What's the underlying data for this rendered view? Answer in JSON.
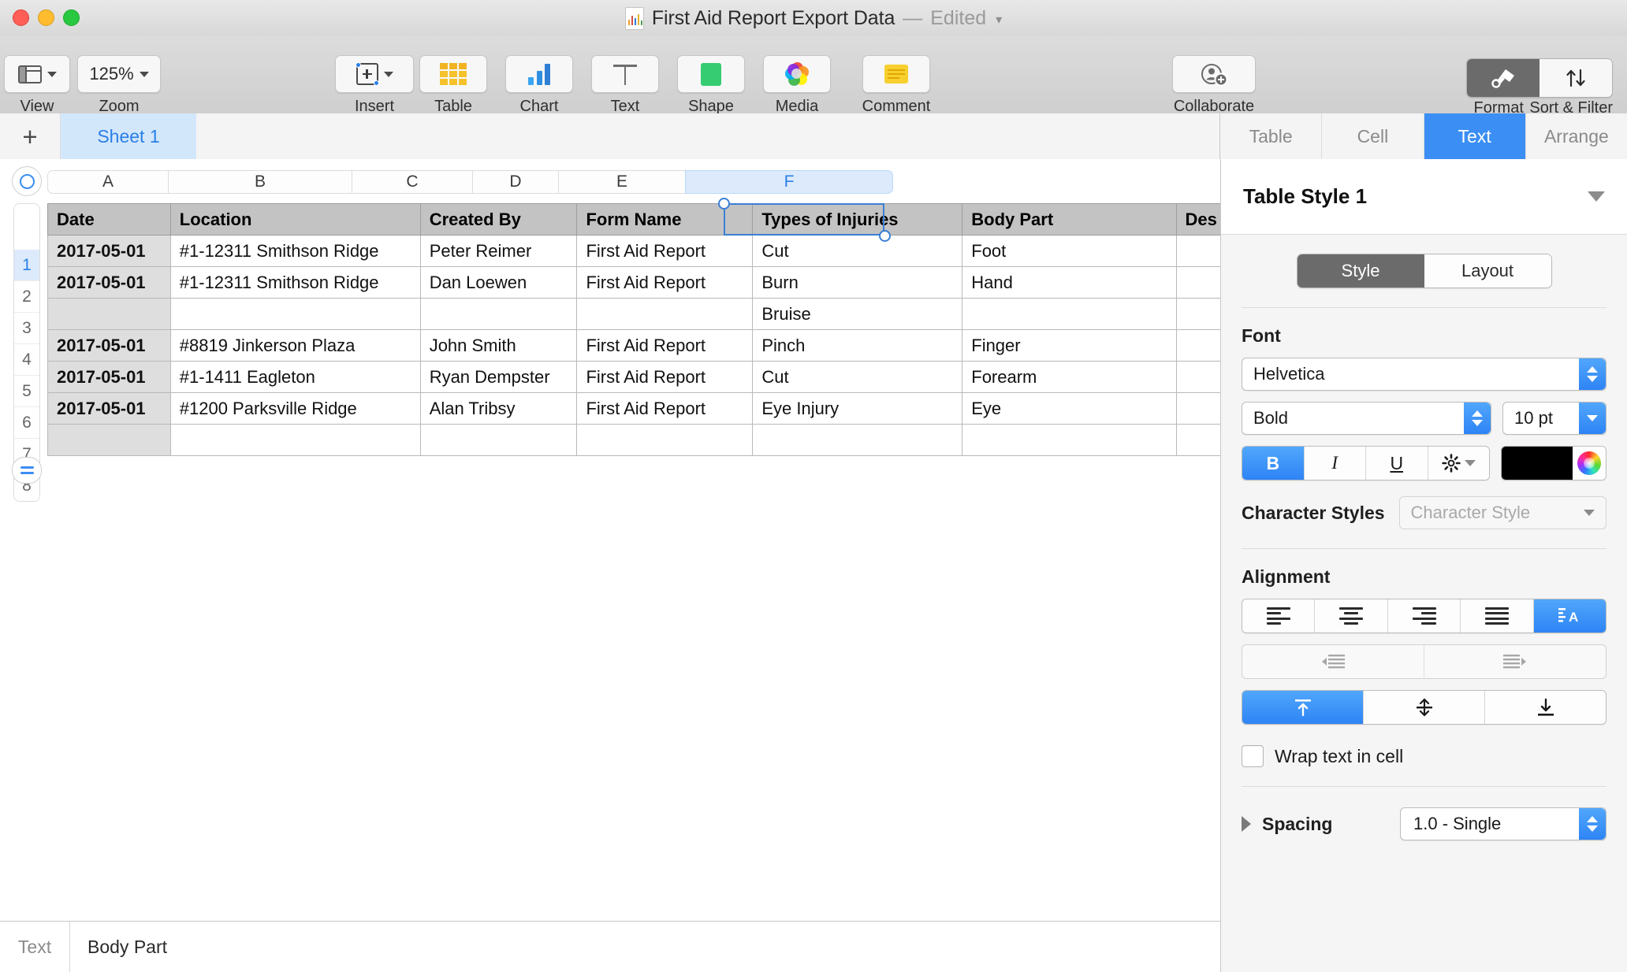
{
  "window": {
    "title": "First Aid Report Export Data",
    "dash": "—",
    "edited": "Edited",
    "doc_icon": "numbers-document-icon"
  },
  "toolbar": {
    "view_label": "View",
    "zoom_label": "Zoom",
    "zoom_value": "125%",
    "insert_label": "Insert",
    "table_label": "Table",
    "chart_label": "Chart",
    "text_label": "Text",
    "shape_label": "Shape",
    "media_label": "Media",
    "comment_label": "Comment",
    "collaborate_label": "Collaborate",
    "format_label": "Format",
    "sort_filter_label": "Sort & Filter"
  },
  "sheetbar": {
    "add_label": "+",
    "tabs": [
      {
        "label": "Sheet 1",
        "active": true
      }
    ]
  },
  "inspector_tabs": [
    {
      "label": "Table",
      "active": false
    },
    {
      "label": "Cell",
      "active": false
    },
    {
      "label": "Text",
      "active": true
    },
    {
      "label": "Arrange",
      "active": false
    }
  ],
  "spreadsheet": {
    "column_letters": [
      "A",
      "B",
      "C",
      "D",
      "E",
      "F"
    ],
    "selected_column": "F",
    "row_numbers": [
      "1",
      "2",
      "3",
      "4",
      "5",
      "6",
      "7",
      "8"
    ],
    "selected_row": "1",
    "headers": [
      "Date",
      "Location",
      "Created By",
      "Form Name",
      "Types of Injuries",
      "Body Part",
      "Des"
    ],
    "selected_cell": "Body Part",
    "rows": [
      [
        "2017-05-01",
        "#1-12311 Smithson Ridge",
        "Peter Reimer",
        "First Aid Report",
        "Cut",
        "Foot",
        ""
      ],
      [
        "2017-05-01",
        "#1-12311 Smithson Ridge",
        "Dan Loewen",
        "First Aid Report",
        "Burn",
        "Hand",
        ""
      ],
      [
        "",
        "",
        "",
        "",
        "Bruise",
        "",
        ""
      ],
      [
        "2017-05-01",
        "#8819 Jinkerson Plaza",
        "John Smith",
        "First Aid Report",
        "Pinch",
        "Finger",
        ""
      ],
      [
        "2017-05-01",
        "#1-1411 Eagleton",
        "Ryan Dempster",
        "First Aid Report",
        "Cut",
        "Forearm",
        ""
      ],
      [
        "2017-05-01",
        "#1200 Parksville Ridge",
        "Alan Tribsy",
        "First Aid Report",
        "Eye Injury",
        "Eye",
        ""
      ],
      [
        "",
        "",
        "",
        "",
        "",
        "",
        ""
      ]
    ]
  },
  "statusbar": {
    "label": "Text",
    "value": "Body Part"
  },
  "format_panel": {
    "title": "Table Style 1",
    "style_tab": "Style",
    "layout_tab": "Layout",
    "font_section": "Font",
    "font_family": "Helvetica",
    "font_style": "Bold",
    "font_size": "10 pt",
    "bold_label": "B",
    "italic_label": "I",
    "underline_label": "U",
    "gear_label": "gear",
    "text_color": "#000000",
    "character_styles_label": "Character Styles",
    "character_style_placeholder": "Character Style",
    "alignment_section": "Alignment",
    "wrap_label": "Wrap text in cell",
    "wrap_checked": false,
    "spacing_label": "Spacing",
    "spacing_value": "1.0 - Single",
    "accent_color": "#3b8ef3",
    "selection_color": "#3b7fd4"
  }
}
